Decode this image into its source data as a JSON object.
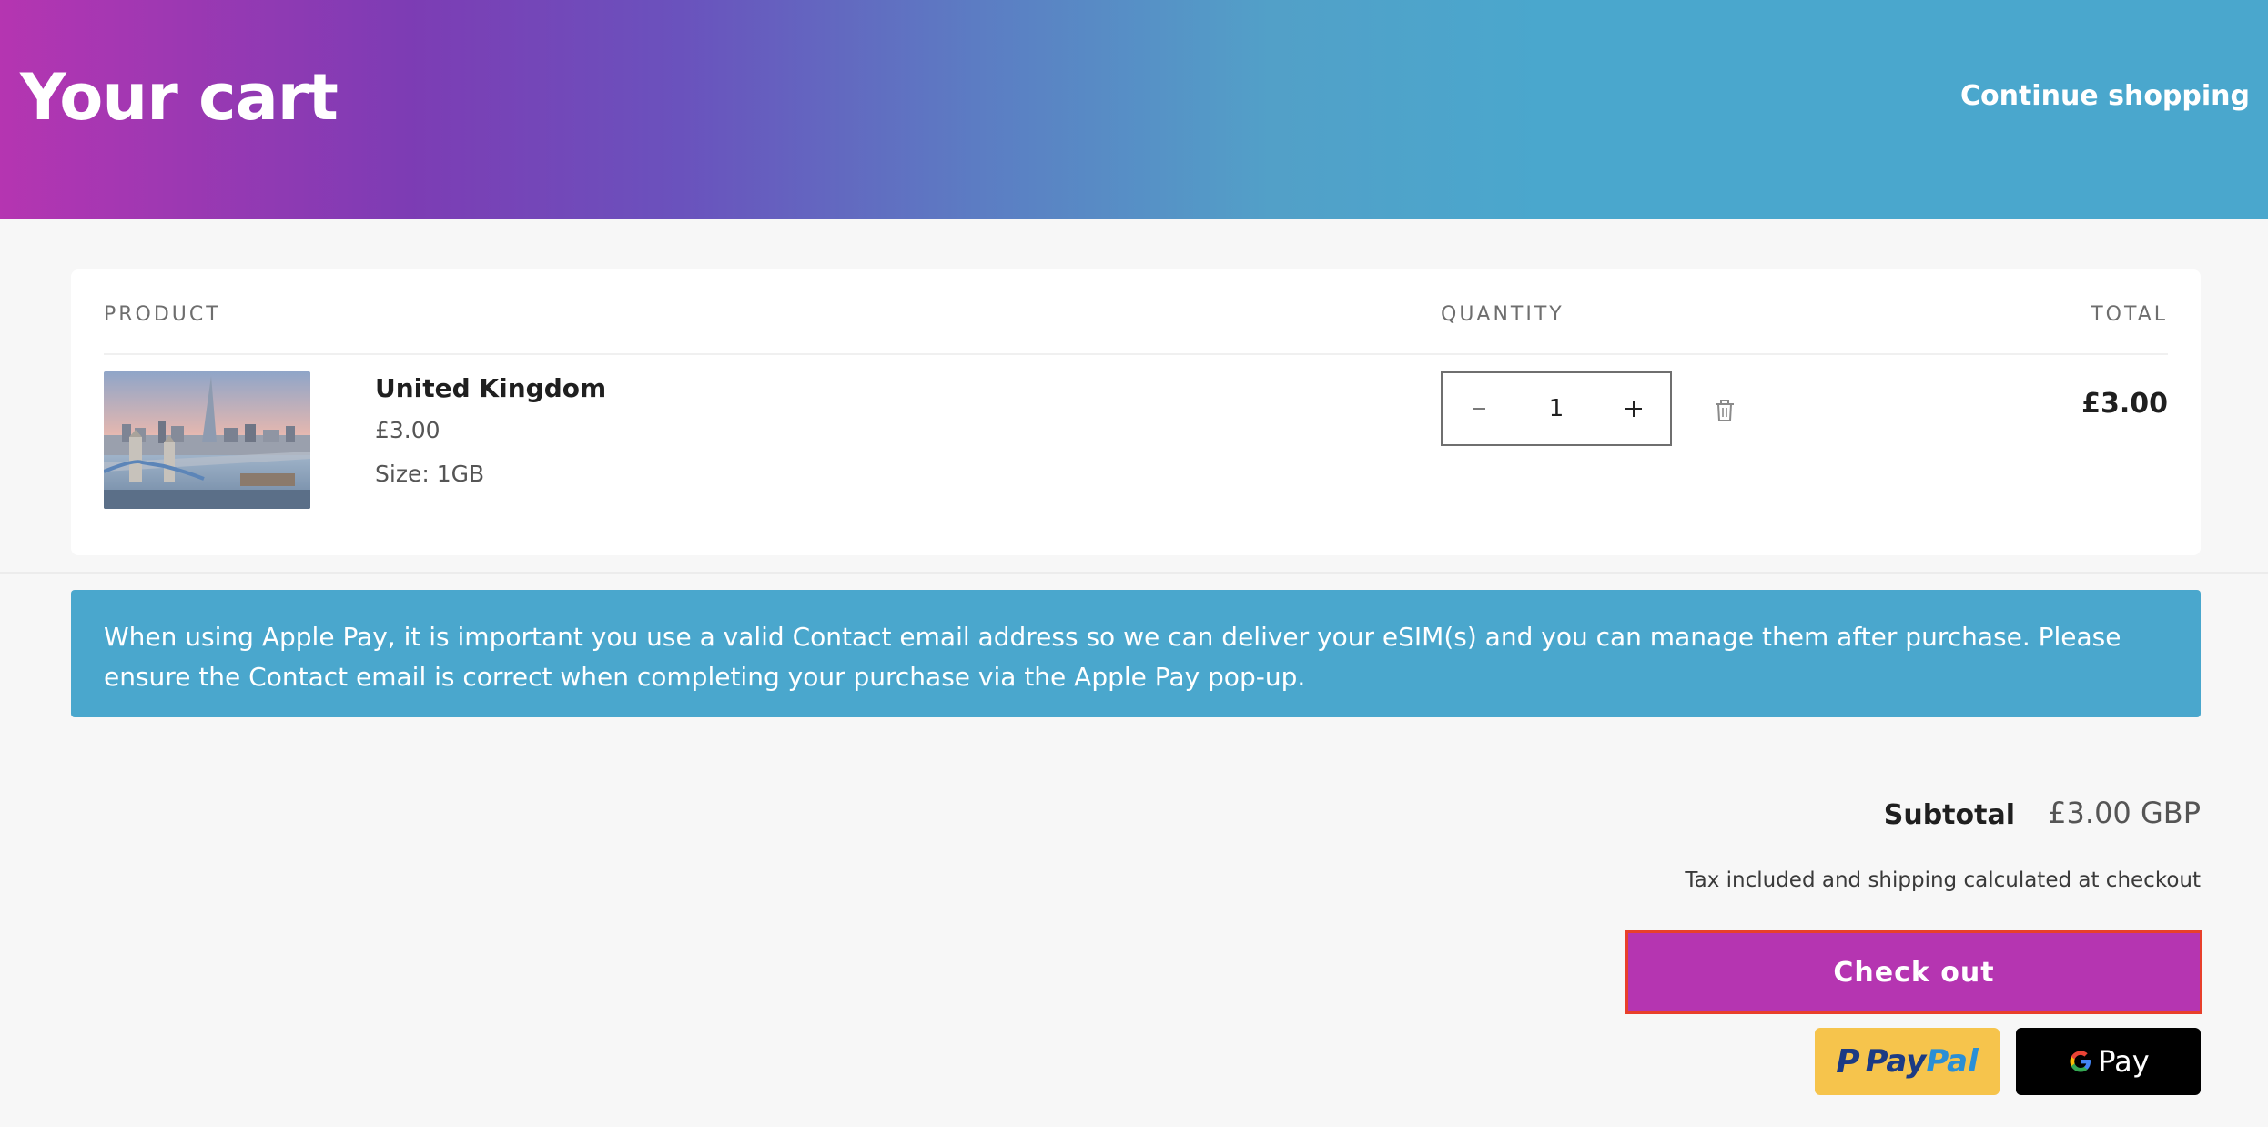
{
  "header": {
    "title": "Your cart",
    "continue_label": "Continue shopping"
  },
  "cart": {
    "columns": {
      "product": "PRODUCT",
      "quantity": "QUANTITY",
      "total": "TOTAL"
    },
    "item": {
      "name": "United Kingdom",
      "price": "£3.00",
      "size": "Size: 1GB",
      "quantity": "1",
      "line_total": "£3.00",
      "image": "london-tower-bridge-photo"
    },
    "icons": {
      "decrease": "minus-icon",
      "increase": "plus-icon",
      "remove": "trash-icon"
    }
  },
  "notice": {
    "text": "When using Apple Pay, it is important you use a valid Contact email address so we can deliver your eSIM(s) and you can manage them after purchase. Please ensure the Contact email is correct when completing your purchase via the Apple Pay pop-up."
  },
  "summary": {
    "subtotal_label": "Subtotal",
    "subtotal_value": "£3.00 GBP",
    "tax_note": "Tax included and shipping calculated at checkout",
    "checkout_label": "Check out"
  },
  "payments": {
    "paypal_pay": "Pay",
    "paypal_pal": "Pal",
    "gpay_label": "Pay"
  },
  "colors": {
    "brand_purple": "#b535b1",
    "brand_blue": "#4aa7cd",
    "highlight_border": "#e8402b"
  }
}
